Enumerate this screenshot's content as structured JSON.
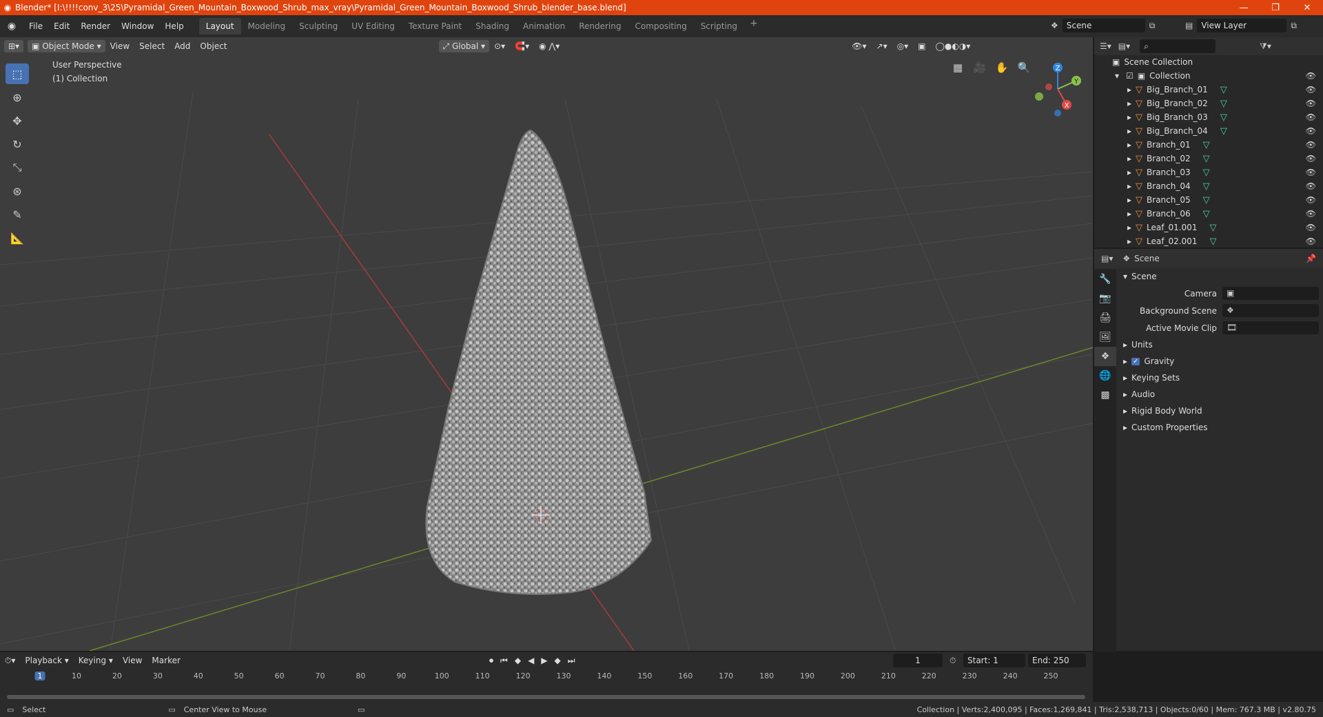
{
  "window": {
    "title": "Blender* [I:\\!!!!conv_3\\25\\Pyramidal_Green_Mountain_Boxwood_Shrub_max_vray\\Pyramidal_Green_Mountain_Boxwood_Shrub_blender_base.blend]",
    "minimize": "—",
    "restore": "❐",
    "close": "✕"
  },
  "menu": [
    "File",
    "Edit",
    "Render",
    "Window",
    "Help"
  ],
  "workspaces": [
    "Layout",
    "Modeling",
    "Sculpting",
    "UV Editing",
    "Texture Paint",
    "Shading",
    "Animation",
    "Rendering",
    "Compositing",
    "Scripting"
  ],
  "active_workspace": "Layout",
  "scene_name": "Scene",
  "view_layer": "View Layer",
  "viewport": {
    "mode": "Object Mode",
    "menus": [
      "View",
      "Select",
      "Add",
      "Object"
    ],
    "transform": "Global",
    "perspective": "User Perspective",
    "collection": "(1) Collection"
  },
  "gizmo": {
    "x": "X",
    "y": "Y",
    "z": "Z"
  },
  "outliner": {
    "root": "Scene Collection",
    "collection": "Collection",
    "items": [
      "Big_Branch_01",
      "Big_Branch_02",
      "Big_Branch_03",
      "Big_Branch_04",
      "Branch_01",
      "Branch_02",
      "Branch_03",
      "Branch_04",
      "Branch_05",
      "Branch_06",
      "Leaf_01.001",
      "Leaf_02.001"
    ]
  },
  "properties": {
    "header": "Scene",
    "section": "Scene",
    "fields": [
      {
        "label": "Camera",
        "value": ""
      },
      {
        "label": "Background Scene",
        "value": ""
      },
      {
        "label": "Active Movie Clip",
        "value": ""
      }
    ],
    "subsections": [
      "Units",
      "Gravity",
      "Keying Sets",
      "Audio",
      "Rigid Body World",
      "Custom Properties"
    ]
  },
  "timeline": {
    "menus": [
      "Playback",
      "Keying",
      "View",
      "Marker"
    ],
    "current_frame": "1",
    "start_label": "Start:",
    "start": "1",
    "end_label": "End:",
    "end": "250",
    "ticks": [
      "1",
      "10",
      "20",
      "30",
      "40",
      "50",
      "60",
      "70",
      "80",
      "90",
      "100",
      "110",
      "120",
      "130",
      "140",
      "150",
      "160",
      "170",
      "180",
      "190",
      "200",
      "210",
      "220",
      "230",
      "240",
      "250"
    ]
  },
  "statusbar": {
    "left1": "Select",
    "left2": "Center View to Mouse",
    "right": "Collection | Verts:2,400,095 | Faces:1,269,841 | Tris:2,538,713 | Objects:0/60 | Mem: 767.3 MB | v2.80.75"
  },
  "colors": {
    "accent": "#4772b3",
    "titlebar": "#e0440e",
    "x_axis": "#e0484a",
    "y_axis": "#8bc34a",
    "z_axis": "#2f86e0"
  }
}
